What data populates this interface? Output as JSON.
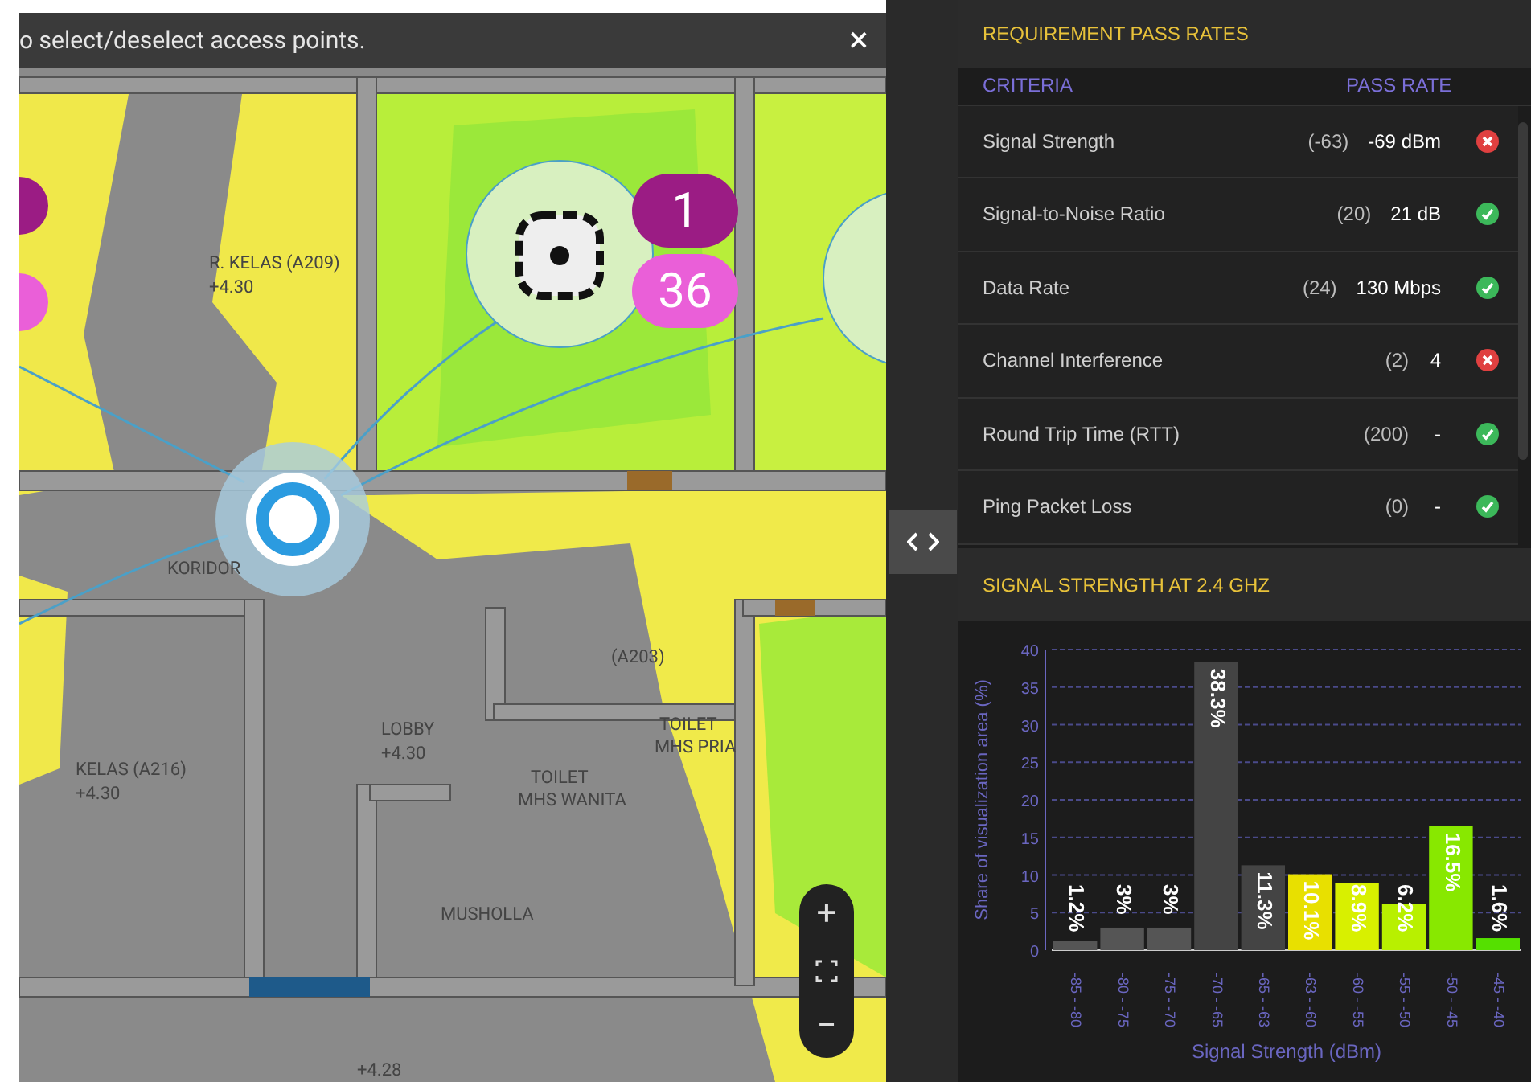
{
  "map": {
    "banner": "o select/deselect access points.",
    "close": "×",
    "ap_badges": [
      {
        "label": "1",
        "color": "#9b1c84"
      },
      {
        "label": "36",
        "color": "#ea5fd8"
      }
    ],
    "room_labels": [
      "R. KELAS (A209)",
      "+4.30",
      "KORIDOR",
      "(A203)",
      "LOBBY",
      "+4.30",
      "KELAS (A216)",
      "+4.30",
      "MUSHOLLA",
      "TOILET",
      "MHS WANITA",
      "TOILET",
      "MHS PRIA",
      "+4.28"
    ],
    "zoom": {
      "plus": "+",
      "minus": "−"
    }
  },
  "requirements": {
    "title": "REQUIREMENT PASS RATES",
    "columns": [
      "CRITERIA",
      "PASS RATE"
    ],
    "rows": [
      {
        "name": "Signal Strength",
        "threshold": "(-63)",
        "value": "-69 dBm",
        "passed": false
      },
      {
        "name": "Signal-to-Noise Ratio",
        "threshold": "(20)",
        "value": "21 dB",
        "passed": true
      },
      {
        "name": "Data Rate",
        "threshold": "(24)",
        "value": "130 Mbps",
        "passed": true
      },
      {
        "name": "Channel Interference",
        "threshold": "(2)",
        "value": "4",
        "passed": false
      },
      {
        "name": "Round Trip Time (RTT)",
        "threshold": "(200)",
        "value": "-",
        "passed": true
      },
      {
        "name": "Ping Packet Loss",
        "threshold": "(0)",
        "value": "-",
        "passed": true
      }
    ]
  },
  "signal_chart": {
    "title": "SIGNAL STRENGTH AT 2.4 GHZ",
    "chart_data": {
      "type": "bar",
      "xlabel": "Signal Strength (dBm)",
      "ylabel": "Share of visualization area (%)",
      "categories": [
        "-85 - -80",
        "-80 - -75",
        "-75 - -70",
        "-70 - -65",
        "-65 - -63",
        "-63 - -60",
        "-60 - -55",
        "-55 - -50",
        "-50 - -45",
        "-45 - -40"
      ],
      "series": [
        {
          "color": "#555555",
          "values": [
            1.2,
            3,
            3,
            null,
            null,
            null,
            null,
            null,
            null,
            null
          ]
        },
        {
          "color": "#444444",
          "values": [
            null,
            null,
            null,
            38.3,
            11.3,
            null,
            null,
            null,
            null,
            null
          ]
        },
        {
          "color": "#e8e000",
          "values": [
            null,
            null,
            null,
            null,
            null,
            10.1,
            null,
            null,
            null,
            null
          ]
        },
        {
          "color": "#d8f000",
          "values": [
            null,
            null,
            null,
            null,
            null,
            null,
            8.9,
            null,
            null,
            null
          ]
        },
        {
          "color": "#b8f000",
          "values": [
            null,
            null,
            null,
            null,
            null,
            null,
            null,
            6.2,
            null,
            null
          ]
        },
        {
          "color": "#88e800",
          "values": [
            null,
            null,
            null,
            null,
            null,
            null,
            null,
            null,
            16.5,
            null
          ]
        },
        {
          "color": "#55e000",
          "values": [
            null,
            null,
            null,
            null,
            null,
            null,
            null,
            null,
            null,
            1.6
          ]
        }
      ],
      "grid": true,
      "value_labels": [
        "1.2%",
        "3%",
        "3%",
        "38.3%",
        "11.3%",
        "10.1%",
        "8.9%",
        "6.2%",
        "16.5%",
        "1.6%"
      ],
      "ylim": [
        0,
        40
      ],
      "yticks": [
        0,
        5,
        10,
        15,
        20,
        25,
        30,
        35,
        40
      ]
    }
  }
}
